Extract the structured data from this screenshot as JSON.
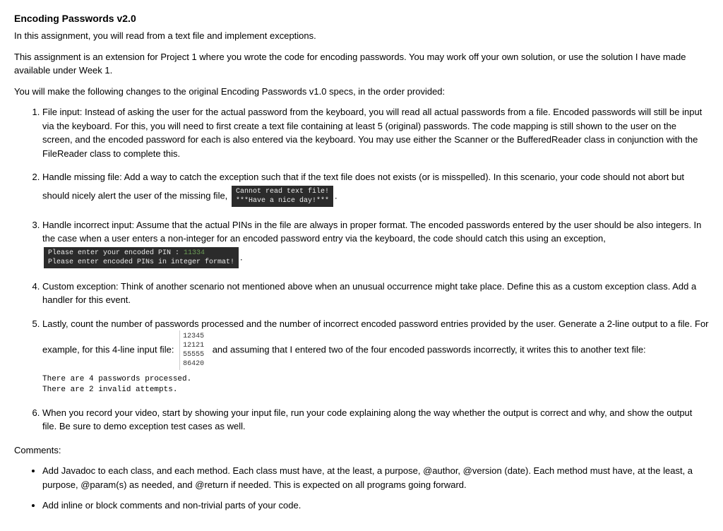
{
  "title": "Encoding Passwords v2.0",
  "intro1": "In this assignment, you will read from a text file and implement exceptions.",
  "intro2": "This assignment is an extension for Project 1 where you wrote the code for encoding passwords. You may work off your own solution, or use the solution I have made available under Week 1.",
  "intro3": "You will make the following changes to the original Encoding Passwords v1.0 specs, in the order provided:",
  "steps": {
    "s1": "File input: Instead of asking the user for the actual password from the keyboard, you will read all actual passwords from a file. Encoded passwords will still be input via the keyboard. For this, you will need to first create a text file containing at least 5 (original) passwords. The code mapping is still shown to the user on the screen, and the encoded password for each is also entered via the keyboard. You may use either the Scanner or the BufferedReader class in conjunction with the FileReader class to complete this.",
    "s2a": "Handle missing file: Add a way to catch the exception such that if the text file does not exists (or is misspelled). In this scenario, your code should not abort but should nicely alert the user of the missing file,",
    "s2_code_line1": "Cannot read text file!",
    "s2_code_line2": "***Have a nice day!***",
    "s2_period": ".",
    "s3a": "Handle incorrect input: Assume that the actual PINs in the file are always in proper format. The encoded passwords entered by the user should be also integers. In the case when a user enters a non-integer for an encoded password entry via the keyboard, the code should catch this using an exception,",
    "s3_code_line1a": "Please enter your encoded PIN : ",
    "s3_code_line1b": "11334",
    "s3_code_line2": "Please enter encoded PINs in integer format!",
    "s3_period": ".",
    "s4": "Custom exception: Think of another scenario not mentioned above when an unusual occurrence might take place. Define this as a custom exception class. Add a handler for this event.",
    "s5a": "Lastly, count the number of passwords processed and the number of incorrect encoded password entries provided by the user. Generate a 2-line output to a file. For example, for this 4-line input file:",
    "s5_input": "12345\n12121\n55555\n86420",
    "s5b": "and assuming that I entered two of the four encoded passwords incorrectly, it writes this to another text file:",
    "s5_output": "There are 4 passwords processed.\nThere are 2 invalid attempts.",
    "s6": "When you record your video, start by showing your input file, run your code explaining along the way whether the output is correct and why, and show the output file. Be sure to demo exception test cases as well."
  },
  "comments_heading": "Comments:",
  "comments": {
    "c1": "Add Javadoc to each class, and each method. Each class must have, at the least, a purpose, @author, @version (date). Each method must have, at the least, a purpose, @param(s) as needed, and @return if needed. This is expected on all programs going forward.",
    "c2": "Add inline or block comments and non-trivial parts of your code."
  }
}
